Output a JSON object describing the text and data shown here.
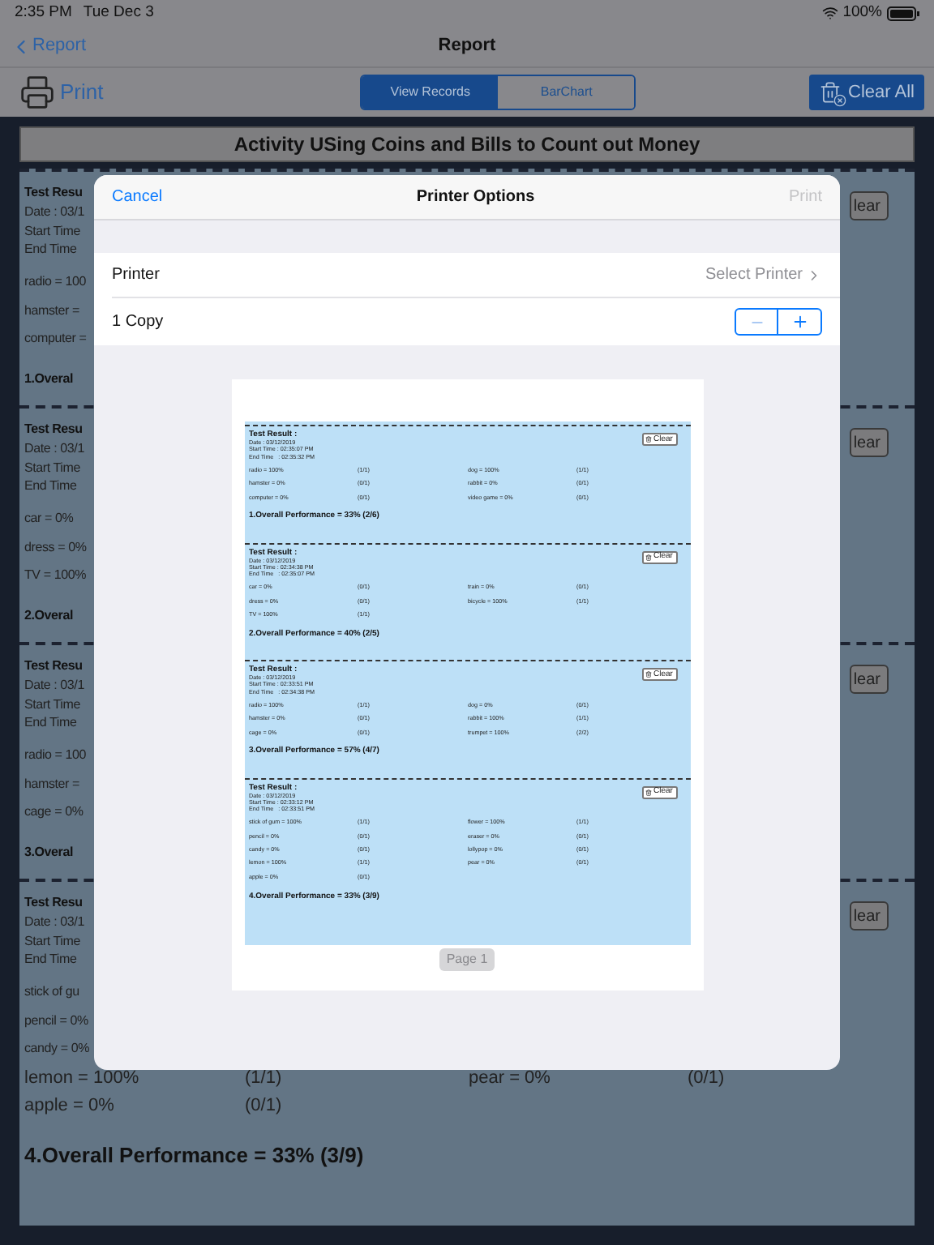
{
  "status_bar": {
    "time": "2:35 PM",
    "date": "Tue Dec 3",
    "battery": "100%"
  },
  "nav": {
    "back": "Report",
    "title": "Report"
  },
  "toolbar": {
    "print": "Print",
    "segments": [
      {
        "label": "View Records",
        "selected": true
      },
      {
        "label": "BarChart",
        "selected": false
      }
    ],
    "clear_all": "Clear All"
  },
  "report_title": "Activity USing Coins and Bills to Count out Money",
  "records": [
    {
      "lines": [
        "Test Resu",
        "Date : 03/1",
        "Start Time",
        "End Time"
      ],
      "items": [
        [
          "radio = 100"
        ],
        [
          "hamster ="
        ],
        [
          "computer ="
        ]
      ],
      "overall": "1.Overal",
      "clear": "lear"
    },
    {
      "lines": [
        "Test Resu",
        "Date : 03/1",
        "Start Time",
        "End Time"
      ],
      "items": [
        [
          "car = 0%"
        ],
        [
          "dress = 0%"
        ],
        [
          "TV = 100%"
        ]
      ],
      "overall": "2.Overal",
      "clear": "lear"
    },
    {
      "lines": [
        "Test Resu",
        "Date : 03/1",
        "Start Time",
        "End Time"
      ],
      "items": [
        [
          "radio = 100"
        ],
        [
          "hamster ="
        ],
        [
          "cage = 0%"
        ]
      ],
      "overall": "3.Overal",
      "clear": "lear"
    },
    {
      "lines": [
        "Test Resu",
        "Date : 03/1",
        "Start Time",
        "End Time"
      ],
      "items": [
        [
          "stick of gu"
        ],
        [
          "pencil = 0%"
        ],
        [
          "candy = 0%"
        ],
        [
          "lemon = 100%",
          "(1/1)",
          "pear = 0%",
          "(0/1)"
        ],
        [
          "apple = 0%",
          "(0/1)"
        ]
      ],
      "overall": "4.Overall Performance = 33% (3/9)",
      "clear": "lear"
    }
  ],
  "dialog": {
    "cancel": "Cancel",
    "title": "Printer Options",
    "print": "Print",
    "print_disabled": true,
    "printer_label": "Printer",
    "printer_value": "Select Printer",
    "copies": "1 Copy",
    "preview": {
      "page_label": "Page 1",
      "records": [
        {
          "title": "Test Result :",
          "lines": [
            "Date : 03/12/2019",
            "Start Time : 02:35:07 PM",
            "End Time   : 02:35:32 PM"
          ],
          "clear": "Clear",
          "items": [
            [
              "radio = 100%",
              "(1/1)",
              "dog = 100%",
              "(1/1)"
            ],
            [
              "hamster = 0%",
              "(0/1)",
              "rabbit = 0%",
              "(0/1)"
            ],
            [
              "computer = 0%",
              "(0/1)",
              "video game = 0%",
              "(0/1)"
            ]
          ],
          "overall": "1.Overall Performance = 33% (2/6)"
        },
        {
          "title": "Test Result :",
          "lines": [
            "Date : 03/12/2019",
            "Start Time : 02:34:38 PM",
            "End Time   : 02:35:07 PM"
          ],
          "clear": "Clear",
          "items": [
            [
              "car = 0%",
              "(0/1)",
              "train = 0%",
              "(0/1)"
            ],
            [
              "dress = 0%",
              "(0/1)",
              "bicycle = 100%",
              "(1/1)"
            ],
            [
              "TV = 100%",
              "(1/1)"
            ]
          ],
          "overall": "2.Overall Performance = 40% (2/5)"
        },
        {
          "title": "Test Result :",
          "lines": [
            "Date : 03/12/2019",
            "Start Time : 02:33:51 PM",
            "End Time   : 02:34:38 PM"
          ],
          "clear": "Clear",
          "items": [
            [
              "radio = 100%",
              "(1/1)",
              "dog = 0%",
              "(0/1)"
            ],
            [
              "hamster = 0%",
              "(0/1)",
              "rabbit = 100%",
              "(1/1)"
            ],
            [
              "cage = 0%",
              "(0/1)",
              "trumpet = 100%",
              "(2/2)"
            ]
          ],
          "overall": "3.Overall Performance = 57% (4/7)"
        },
        {
          "title": "Test Result :",
          "lines": [
            "Date : 03/12/2019",
            "Start Time : 02:33:12 PM",
            "End Time   : 02:33:51 PM"
          ],
          "clear": "Clear",
          "items": [
            [
              "stick of gum = 100%",
              "(1/1)",
              "flower = 100%",
              "(1/1)"
            ],
            [
              "pencil = 0%",
              "(0/1)",
              "eraser = 0%",
              "(0/1)"
            ],
            [
              "candy = 0%",
              "(0/1)",
              "lollypop = 0%",
              "(0/1)"
            ],
            [
              "lemon = 100%",
              "(1/1)",
              "pear = 0%",
              "(0/1)"
            ],
            [
              "apple = 0%",
              "(0/1)"
            ]
          ],
          "overall": "4.Overall Performance = 33% (3/9)"
        }
      ]
    }
  }
}
